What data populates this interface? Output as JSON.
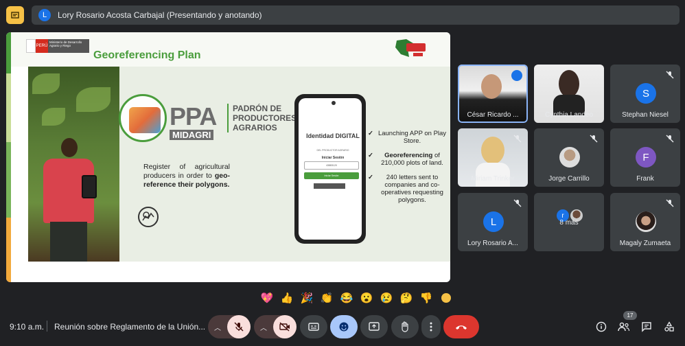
{
  "presenter": {
    "initial": "L",
    "text": "Lory Rosario Acosta Carbajal (Presentando y anotando)"
  },
  "slide": {
    "logo_red_text": "PERÚ",
    "logo_grey_text": "Ministerio de Desarrollo Agrario y Riego",
    "title": "Georeferencing Plan",
    "ppa": "PPA",
    "midagri": "MIDAGRI",
    "padron": "PADRÓN DE PRODUCTORES AGRARIOS",
    "desc_plain_1": "Register of agricultural producers in order to ",
    "desc_bold": "geo-reference their polygons.",
    "app_title": "Identidad DIGITAL",
    "app_sub": "DEL PRODUCTOR AGRARIO",
    "login_label": "Iniciar Sesión",
    "login_field": "43883120",
    "login_button": "Iniciar Sesión",
    "bullets": [
      {
        "bold": "",
        "text": "Launching APP on Play Store."
      },
      {
        "bold": "Georeferencing",
        "text": " of 210,000 plots of land."
      },
      {
        "bold": "",
        "text": "240 letters sent to companies and co-operatives requesting polygons."
      }
    ]
  },
  "participants": [
    {
      "name": "César Ricardo ...",
      "type": "video",
      "active": true
    },
    {
      "name": "Cynthia Landeo",
      "type": "video"
    },
    {
      "name": "Stephan Niesel",
      "type": "initial",
      "initial": "S",
      "color": "#1a73e8",
      "muted": true
    },
    {
      "name": "Miriam Trinker",
      "type": "video",
      "muted": true
    },
    {
      "name": "Jorge Carrillo",
      "type": "photo",
      "muted": true
    },
    {
      "name": "Frank",
      "type": "initial",
      "initial": "F",
      "color": "#7e57c2",
      "muted": true
    },
    {
      "name": "Lory Rosario A...",
      "type": "initial",
      "initial": "L",
      "color": "#1a73e8",
      "muted": true
    },
    {
      "name": "8 más",
      "type": "group",
      "initial": "r"
    },
    {
      "name": "Magaly Zumaeta",
      "type": "photo",
      "muted": true
    }
  ],
  "reactions": [
    "💖",
    "👍",
    "🎉",
    "👏",
    "😂",
    "😮",
    "😢",
    "🤔",
    "👎"
  ],
  "bottom": {
    "time": "9:10 a.m.",
    "meeting": "Reunión sobre Reglamento de la Unión...",
    "people_count": "17"
  },
  "colors": {
    "accent_green": "#4a9d3c",
    "mic_off_bg": "#f9dedc",
    "end_call": "#dc362e",
    "reaction_active": "#a8c7fa"
  }
}
